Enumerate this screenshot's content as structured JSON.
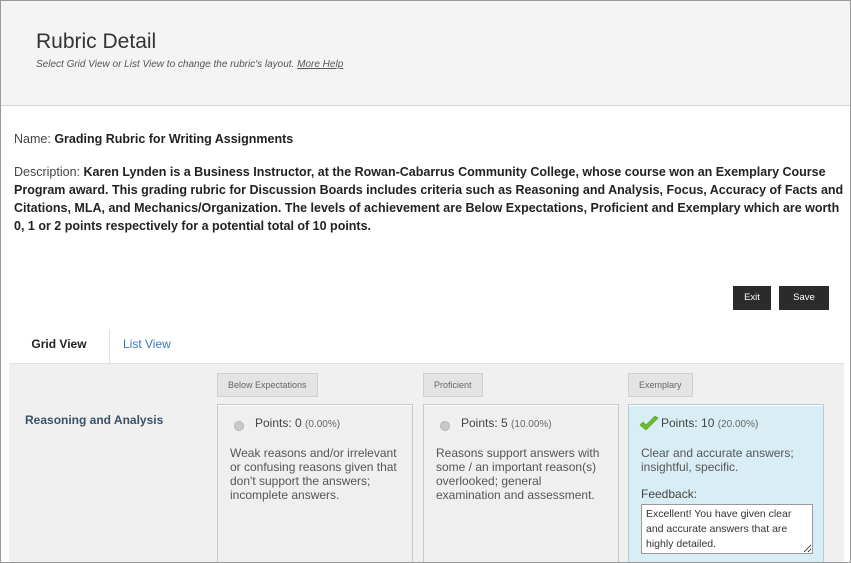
{
  "header": {
    "title": "Rubric Detail",
    "subtitle": "Select Grid View or List View to change the rubric's layout.",
    "help_link": "More Help"
  },
  "rubric": {
    "name_label": "Name:",
    "name": "Grading Rubric for Writing Assignments",
    "description_label": "Description:",
    "description": "Karen Lynden is a Business Instructor, at the Rowan-Cabarrus Community College, whose course won an Exemplary Course Program award. This grading rubric for Discussion Boards includes criteria such as Reasoning and Analysis, Focus, Accuracy of Facts and Citations, MLA, and Mechanics/Organization. The levels of achievement are Below Expectations, Proficient and Exemplary which are worth 0, 1 or 2 points respectively for a potential total of 10 points."
  },
  "buttons": {
    "exit": "Exit",
    "save": "Save"
  },
  "tabs": [
    {
      "label": "Grid View",
      "active": true
    },
    {
      "label": "List View",
      "active": false
    }
  ],
  "grid": {
    "columns": [
      "Below Expectations",
      "Proficient",
      "Exemplary"
    ],
    "criterion": "Reasoning and Analysis",
    "cells": [
      {
        "points": "Points: 0",
        "percent": "(0.00%)",
        "description": "Weak reasons and/or irrelevant or confusing reasons given that don't support the answers; incomplete answers.",
        "selected": false
      },
      {
        "points": "Points: 5",
        "percent": "(10.00%)",
        "description": "Reasons support answers with some / an important reason(s) overlooked; general examination and assessment.",
        "selected": false
      },
      {
        "points": "Points: 10",
        "percent": "(20.00%)",
        "description": "Clear and accurate answers; insightful, specific.",
        "selected": true,
        "feedback_label": "Feedback:",
        "feedback": "Excellent! You have given clear and accurate answers that are highly detailed."
      }
    ]
  },
  "colors": {
    "selected_cell": "#d9eef4",
    "check": "#6cbd2e",
    "link": "#337ab7",
    "button": "#2b2b2b"
  }
}
